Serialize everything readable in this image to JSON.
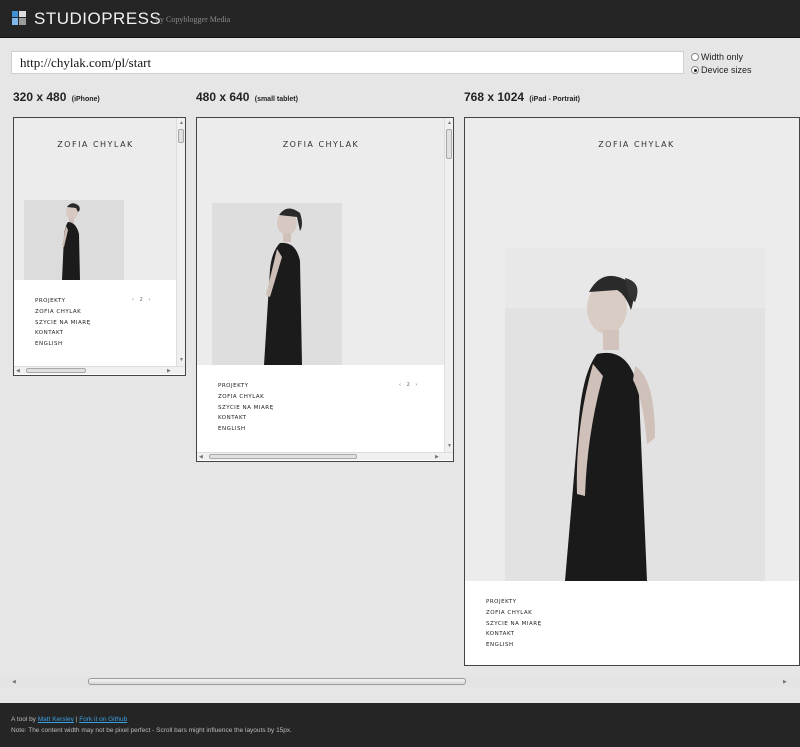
{
  "header": {
    "brand": "STUDIOPRESS",
    "tagline": "by Copyblogger Media",
    "logo_colors": [
      "#3d8fd6",
      "#7fb8ea",
      "#dddddd",
      "#9b9b9b"
    ]
  },
  "url_bar": {
    "value": "http://chylak.com/pl/start"
  },
  "options": {
    "width_only": "Width only",
    "device_sizes": "Device sizes",
    "selected": "device_sizes"
  },
  "devices": [
    {
      "size": "320 x 480",
      "name": "(iPhone)"
    },
    {
      "size": "480 x 640",
      "name": "(small tablet)"
    },
    {
      "size": "768 x 1024",
      "name": "(iPad - Portrait)"
    }
  ],
  "site": {
    "name": "ZOFIA CHYLAK",
    "menu": [
      "PROJEKTY",
      "ZOFIA CHYLAK",
      "SZYCIE NA MIARĘ",
      "KONTAKT",
      "ENGLISH"
    ],
    "pager": "‹ 2 ›"
  },
  "footer": {
    "prefix": "A tool by",
    "author_link": "Matt Kersley",
    "separator": "|",
    "github_link": "Fork it on Github",
    "note": "Note: The content width may not be pixel perfect - Scroll bars might influence the layouts by 15px."
  }
}
